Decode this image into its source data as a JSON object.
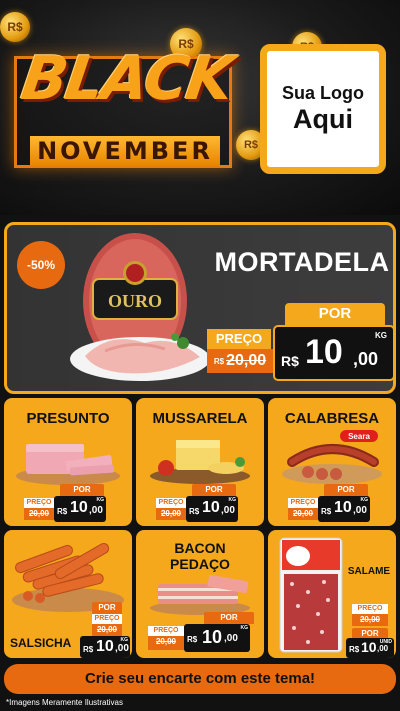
{
  "header": {
    "coin_symbol": "R$",
    "black": "BLACK",
    "november": "NOVEMBER",
    "logo_line1": "Sua Logo",
    "logo_line2": "Aqui"
  },
  "hero": {
    "discount": "-50%",
    "title": "MORTADELA",
    "brand": "OURO",
    "por": "POR",
    "preco_label": "PREÇO",
    "old_cur": "R$",
    "old_price": "20,00",
    "currency": "R$",
    "price_int": "10",
    "price_dec": ",00",
    "unit": "KG"
  },
  "products": [
    {
      "name": "PRESUNTO",
      "preco": "PREÇO",
      "old": "20,00",
      "por": "POR",
      "cur": "R$",
      "int": "10",
      "dec": ",00",
      "unit": "KG"
    },
    {
      "name": "MUSSARELA",
      "preco": "PREÇO",
      "old": "20,00",
      "por": "POR",
      "cur": "R$",
      "int": "10",
      "dec": ",00",
      "unit": "KG"
    },
    {
      "name": "CALABRESA",
      "preco": "PREÇO",
      "old": "20,00",
      "por": "POR",
      "cur": "R$",
      "int": "10",
      "dec": ",00",
      "unit": "KG",
      "brand": "Seara"
    },
    {
      "name": "SALSICHA",
      "preco": "PREÇO",
      "old": "20,00",
      "por": "POR",
      "cur": "R$",
      "int": "10",
      "dec": ",00",
      "unit": "KG"
    },
    {
      "name_line1": "BACON",
      "name_line2": "PEDAÇO",
      "preco": "PREÇO",
      "old": "20,00",
      "por": "POR",
      "cur": "R$",
      "int": "10",
      "dec": ",00",
      "unit": "KG"
    },
    {
      "name": "SALAME",
      "preco": "PREÇO",
      "old": "20,00",
      "por": "POR",
      "cur": "R$",
      "int": "10",
      "dec": ",00",
      "unit": "UNID"
    }
  ],
  "cta": "Crie seu encarte com este tema!",
  "disclaimer": "*Imagens Meramente Ilustrativas",
  "colors": {
    "accent": "#f5a81c",
    "orange": "#e86a10",
    "dark": "#111111"
  }
}
